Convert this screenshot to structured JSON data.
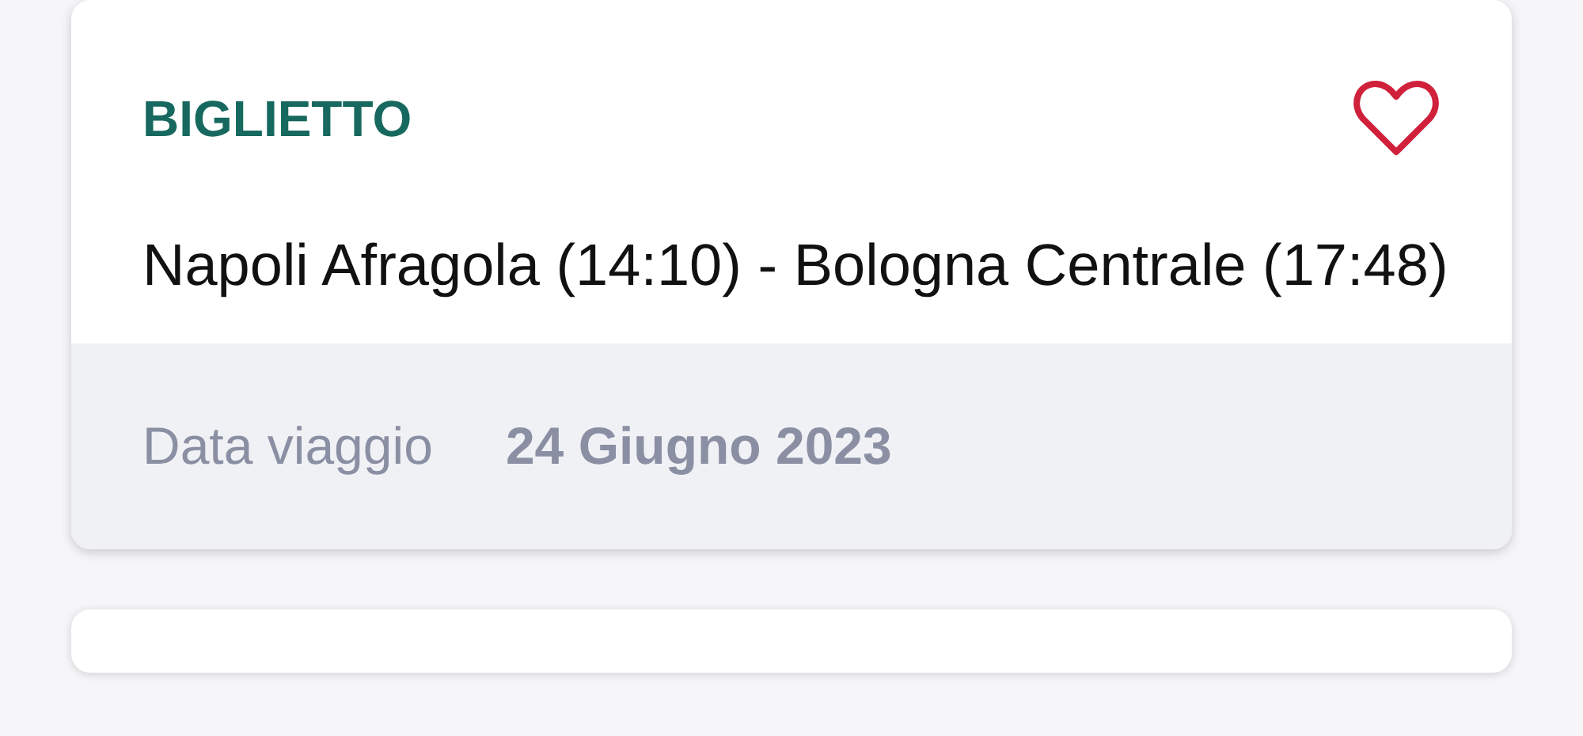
{
  "ticket": {
    "label": "BIGLIETTO",
    "favorite": false,
    "route": "Napoli Afragola (14:10) - Bologna Centrale (17:48)",
    "travel_date_label": "Data viaggio",
    "travel_date": "24 Giugno 2023"
  }
}
